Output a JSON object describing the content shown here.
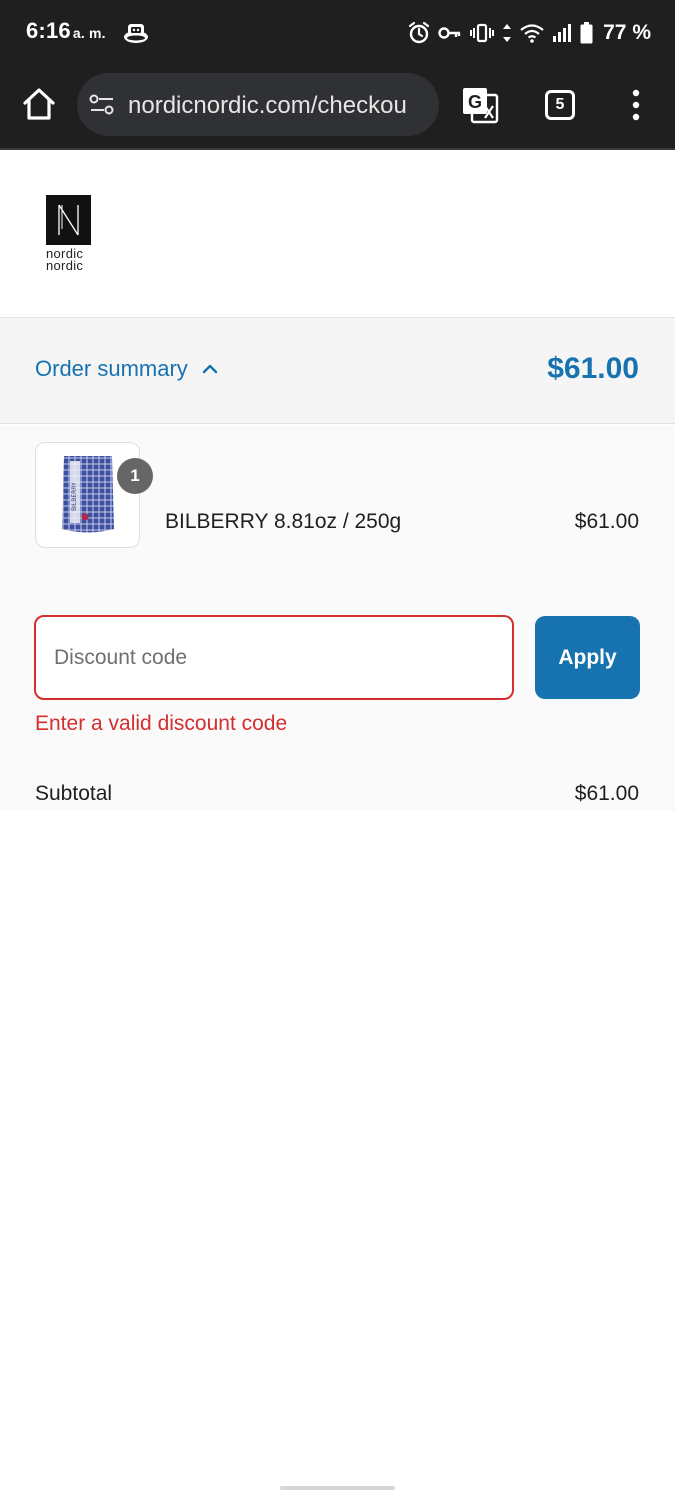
{
  "status_bar": {
    "time": "6:16",
    "ampm": "a. m.",
    "battery": "77 %"
  },
  "browser": {
    "url": "nordicnordic.com/checkou",
    "tab_count": "5"
  },
  "logo": {
    "line1": "nordic",
    "line2": "nordic"
  },
  "order_summary": {
    "toggle_label": "Order summary",
    "total": "$61.00"
  },
  "line_item": {
    "quantity": "1",
    "name": "BILBERRY 8.81oz / 250g",
    "price": "$61.00",
    "package_text": "BILBERRY"
  },
  "discount": {
    "placeholder": "Discount code",
    "value": "",
    "apply_label": "Apply",
    "error": "Enter a valid discount code"
  },
  "totals": {
    "subtotal_label": "Subtotal",
    "subtotal_value": "$61.00"
  },
  "colors": {
    "accent": "#1773b0",
    "error": "#d32f2f",
    "browser_chrome": "#1f1f1f"
  }
}
